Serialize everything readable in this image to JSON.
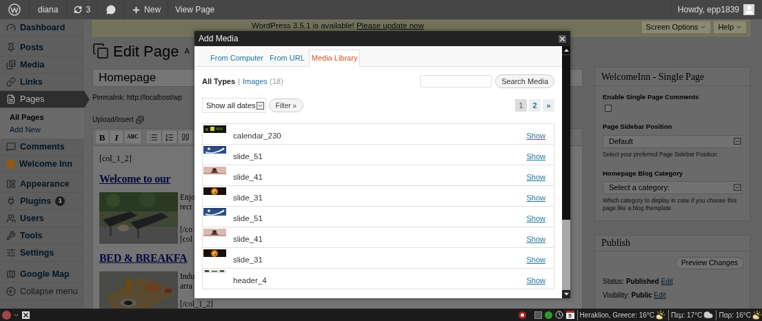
{
  "admin_bar": {
    "site": "diana",
    "updates": "3",
    "new_label": "New",
    "view_page": "View Page",
    "greeting": "Howdy, epp1839"
  },
  "sidebar": {
    "items": [
      {
        "label": "Dashboard",
        "kind": "menu",
        "selected": false
      },
      {
        "label": "Posts",
        "kind": "menu",
        "selected": false
      },
      {
        "label": "Media",
        "kind": "menu",
        "selected": false
      },
      {
        "label": "Links",
        "kind": "menu",
        "selected": false
      },
      {
        "label": "Pages",
        "kind": "menu",
        "selected": true,
        "children": [
          {
            "label": "All Pages",
            "selected": true
          },
          {
            "label": "Add New",
            "selected": false
          }
        ]
      },
      {
        "label": "Comments",
        "kind": "menu",
        "selected": false
      },
      {
        "label": "Welcome Inn",
        "kind": "menu",
        "selected": false
      },
      {
        "label": "Appearance",
        "kind": "menu",
        "selected": false
      },
      {
        "label": "Plugins",
        "kind": "menu",
        "selected": false,
        "badge": "1"
      },
      {
        "label": "Users",
        "kind": "menu",
        "selected": false
      },
      {
        "label": "Tools",
        "kind": "menu",
        "selected": false
      },
      {
        "label": "Settings",
        "kind": "menu",
        "selected": false
      },
      {
        "label": "Google Map",
        "kind": "menu",
        "selected": false
      },
      {
        "label": "Collapse menu",
        "kind": "collapse",
        "selected": false
      }
    ]
  },
  "notice": {
    "text": "WordPress 3.5.1 is available!",
    "link": "Please update now"
  },
  "screen_buttons": [
    "Screen Options",
    "Help"
  ],
  "editor": {
    "heading": "Edit Page",
    "add_new": "A",
    "title": "Homepage",
    "permalink": "Permalink: http://localhost/wp",
    "upload_label": "Upload/Insert",
    "toolbar": [
      "B",
      "I",
      "ABC"
    ],
    "content": [
      {
        "kind": "code",
        "text": "[col_1_2]"
      },
      {
        "kind": "heading",
        "text": "Welcome to our"
      },
      {
        "kind": "figure",
        "paragraphs": [
          [
            "Enjo",
            "recr"
          ],
          [
            "[/co",
            "[col"
          ]
        ]
      },
      {
        "kind": "heading",
        "text": "BED & BREAKFA"
      },
      {
        "kind": "figure",
        "paragraphs": [
          [
            "Indu",
            "arra"
          ],
          [
            "[/col_1_2]"
          ]
        ]
      }
    ]
  },
  "modal": {
    "title": "Add Media",
    "tabs": [
      {
        "label": "From Computer",
        "selected": false
      },
      {
        "label": "From URL",
        "selected": false
      },
      {
        "label": "Media Library",
        "selected": true
      }
    ],
    "filters": [
      {
        "label": "All Types",
        "selected": true
      },
      {
        "label": "Images",
        "count": "(18)",
        "selected": false
      }
    ],
    "separator": "|",
    "search_button": "Search Media",
    "date_filter": "Show all dates",
    "filter_button": "Filter »",
    "pages": [
      {
        "label": "1",
        "selected": true
      },
      {
        "label": "2",
        "selected": false
      },
      {
        "label": "»",
        "selected": false
      }
    ],
    "items": [
      {
        "name": "calendar_230",
        "action": "Show"
      },
      {
        "name": "slide_51",
        "action": "Show"
      },
      {
        "name": "slide_41",
        "action": "Show"
      },
      {
        "name": "slide_31",
        "action": "Show"
      },
      {
        "name": "slide_51",
        "action": "Show"
      },
      {
        "name": "slide_41",
        "action": "Show"
      },
      {
        "name": "slide_31",
        "action": "Show"
      },
      {
        "name": "header_4",
        "action": "Show"
      }
    ]
  },
  "settings_panel": {
    "title": "WelcomeInn - Single Page",
    "fields": [
      {
        "kind": "checkbox",
        "label": "Enable Single Page Comments",
        "checked": false
      },
      {
        "kind": "select",
        "label": "Page Sidebar Position",
        "value": "Default",
        "hint": "Select your preferred Page Sidebar Position."
      },
      {
        "kind": "select",
        "label": "Homepage Blog Category",
        "value": "Select a category:",
        "hint": "Which category to display in case if you choose this page like a blog themplate."
      }
    ]
  },
  "publish_panel": {
    "title": "Publish",
    "preview_button": "Preview Changes",
    "rows": [
      {
        "text": "Status: **Published**",
        "link": "Edit"
      },
      {
        "text": "Visibility: **Public**",
        "link": "Edit"
      }
    ]
  },
  "taskbar": {
    "calendar_day": "5",
    "weather": [
      "Heraklion, Greece: 16°C",
      "Πεμ: 17°C",
      "Παρ: 16°C"
    ]
  }
}
